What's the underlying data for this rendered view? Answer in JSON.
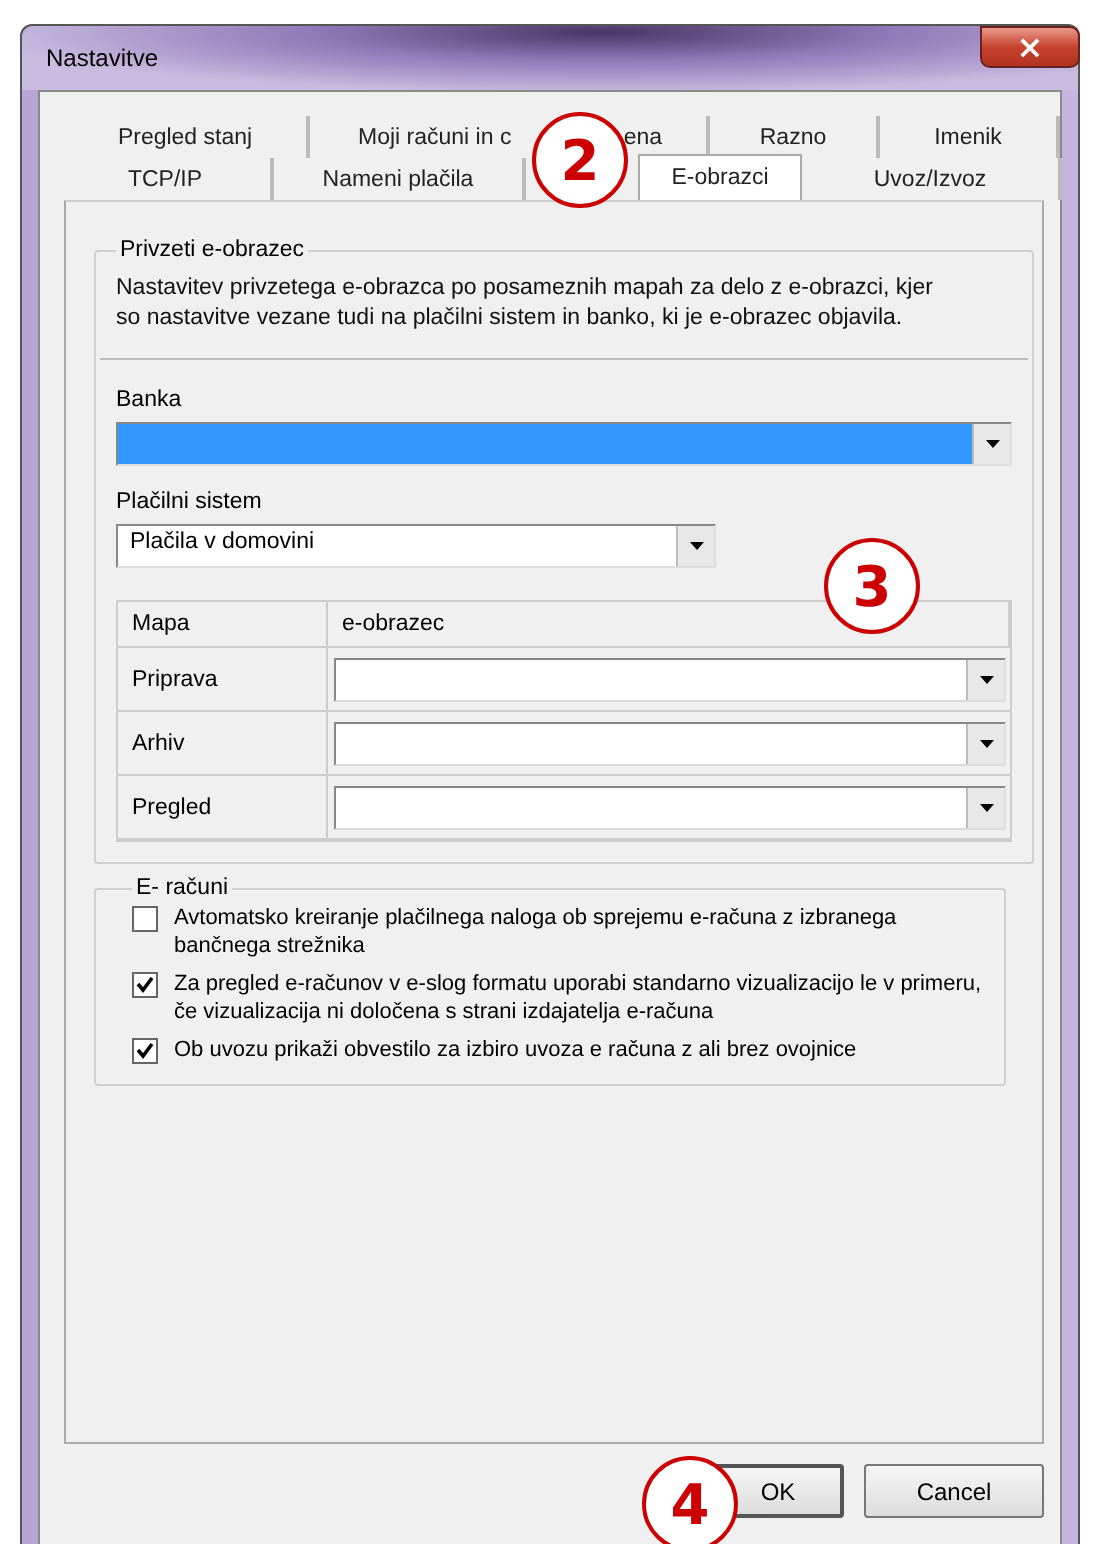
{
  "window": {
    "title": "Nastavitve",
    "close": "×"
  },
  "tabs_back": [
    {
      "label": "Pregled stanj",
      "selected": false
    },
    {
      "label": "Moji računi in c",
      "label_end": "ena",
      "selected": false
    },
    {
      "label": "Razno",
      "selected": false
    },
    {
      "label": "Imenik",
      "selected": false
    }
  ],
  "tabs_front": [
    {
      "label": "TCP/IP",
      "selected": false
    },
    {
      "label": "Nameni plačila",
      "selected": false
    },
    {
      "label": "E-obrazci",
      "selected": true
    },
    {
      "label": "Uvoz/Izvoz",
      "selected": false
    }
  ],
  "default_form": {
    "title": "Privzeti e-obrazec",
    "description": "Nastavitev privzetega e-obrazca po posameznih mapah za delo z e-obrazci, kjer so nastavitve vezane tudi na plačilni sistem in banko, ki je e-obrazec objavila.",
    "bank": {
      "label": "Banka",
      "focused": true
    },
    "payment_system": {
      "label": "Plačilni sistem",
      "value": "Plačila v domovini",
      "focused": false
    },
    "table": {
      "columns": [
        "Mapa",
        "e-obrazec"
      ],
      "rows": [
        {
          "folder": "Priprava"
        },
        {
          "folder": "Arhiv"
        },
        {
          "folder": "Pregled"
        }
      ]
    }
  },
  "e_invoices": {
    "title": "E- računi",
    "options": [
      {
        "label": "Avtomatsko kreiranje plačilnega naloga ob sprejemu e-računa z izbranega bančnega strežnika",
        "checked": false
      },
      {
        "label": "Za pregled e-računov v e-slog formatu uporabi standarno vizualizacijo le v primeru, če vizualizacija ni določena s strani izdajatelja e-računa",
        "checked": true
      },
      {
        "label": "Ob uvozu prikaži obvestilo za izbiro uvoza e računa z ali brez ovojnice",
        "checked": true
      }
    ]
  },
  "buttons": [
    "OK",
    "Cancel"
  ],
  "annotations": [
    {
      "label": "2"
    },
    {
      "label": "3"
    },
    {
      "label": "4"
    }
  ]
}
